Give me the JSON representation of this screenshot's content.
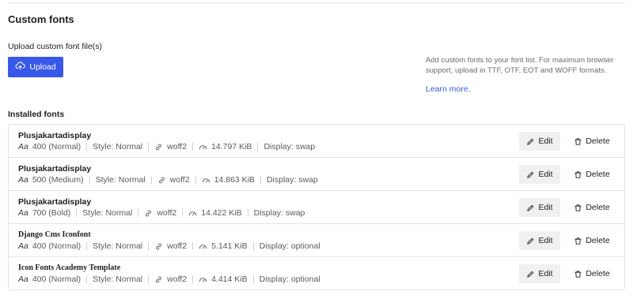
{
  "section_title": "Custom fonts",
  "upload": {
    "label": "Upload custom font file(s)",
    "button_label": "Upload"
  },
  "help": {
    "text": "Add custom fonts to your font list. For maximum browser support, upload in TTF, OTF, EOT and WOFF formats.",
    "link": "Learn more."
  },
  "installed_title": "Installed fonts",
  "actions": {
    "edit": "Edit",
    "delete": "Delete"
  },
  "fonts": [
    {
      "name": "Plusjakartadisplay",
      "aa": "Aa",
      "weight": "400 (Normal)",
      "style": "Style: Normal",
      "format": "woff2",
      "size": "14.797 KiB",
      "display": "Display: swap"
    },
    {
      "name": "Plusjakartadisplay",
      "aa": "Aa",
      "weight": "500 (Medium)",
      "style": "Style: Normal",
      "format": "woff2",
      "size": "14.863 KiB",
      "display": "Display: swap"
    },
    {
      "name": "Plusjakartadisplay",
      "aa": "Aa",
      "weight": "700 (Bold)",
      "style": "Style: Normal",
      "format": "woff2",
      "size": "14.422 KiB",
      "display": "Display: swap"
    },
    {
      "name": "Django Cms Iconfont",
      "aa": "Aa",
      "weight": "400 (Normal)",
      "style": "Style: Normal",
      "format": "woff2",
      "size": "5.141 KiB",
      "display": "Display: optional"
    },
    {
      "name": "Icon Fonts Academy Template",
      "aa": "Aa",
      "weight": "400 (Normal)",
      "style": "Style: Normal",
      "format": "woff2",
      "size": "4.414 KiB",
      "display": "Display: optional"
    }
  ],
  "colors": {
    "primary": "#3858e9",
    "border": "#e4e4e4",
    "muted": "#6b6b6b"
  }
}
